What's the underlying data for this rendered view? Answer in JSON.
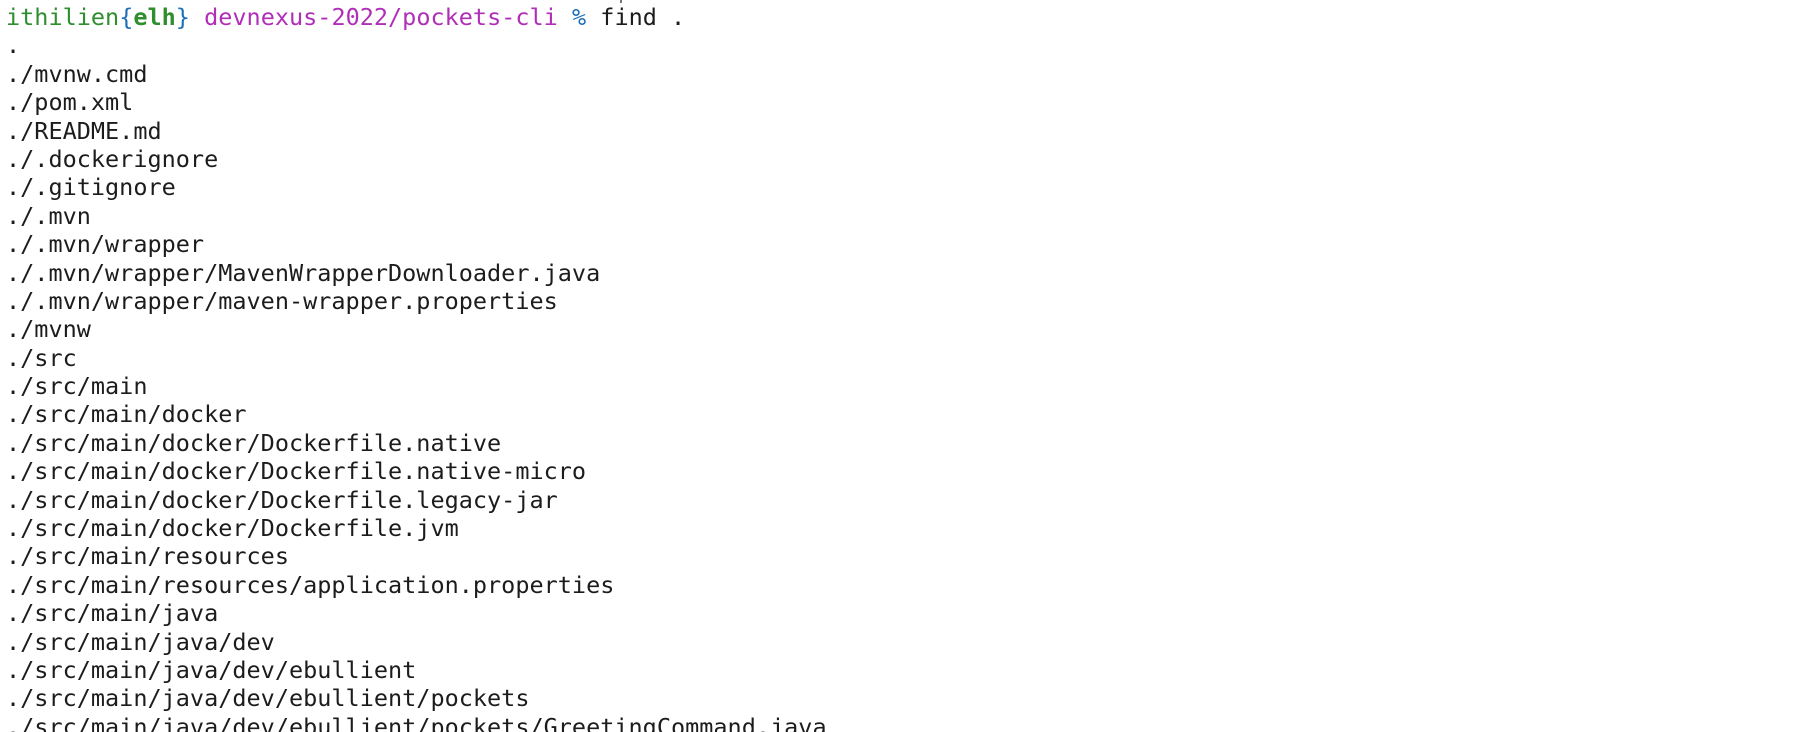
{
  "prompt": {
    "host": "ithilien",
    "brace_open": "{",
    "user": "elh",
    "brace_close": "}",
    "path": "devnexus-2022/pockets-cli",
    "symbol": "%",
    "command": "find ."
  },
  "output": [
    ".",
    "./mvnw.cmd",
    "./pom.xml",
    "./README.md",
    "./.dockerignore",
    "./.gitignore",
    "./.mvn",
    "./.mvn/wrapper",
    "./.mvn/wrapper/MavenWrapperDownloader.java",
    "./.mvn/wrapper/maven-wrapper.properties",
    "./mvnw",
    "./src",
    "./src/main",
    "./src/main/docker",
    "./src/main/docker/Dockerfile.native",
    "./src/main/docker/Dockerfile.native-micro",
    "./src/main/docker/Dockerfile.legacy-jar",
    "./src/main/docker/Dockerfile.jvm",
    "./src/main/resources",
    "./src/main/resources/application.properties",
    "./src/main/java",
    "./src/main/java/dev",
    "./src/main/java/dev/ebullient",
    "./src/main/java/dev/ebullient/pockets",
    "./src/main/java/dev/ebullient/pockets/GreetingCommand.java"
  ],
  "colors": {
    "host": "#2f8f2f",
    "brace": "#1d6fb8",
    "path": "#b02eb8",
    "symbol": "#1d6fb8",
    "text": "#1c1c1c",
    "background": "#ffffff"
  }
}
